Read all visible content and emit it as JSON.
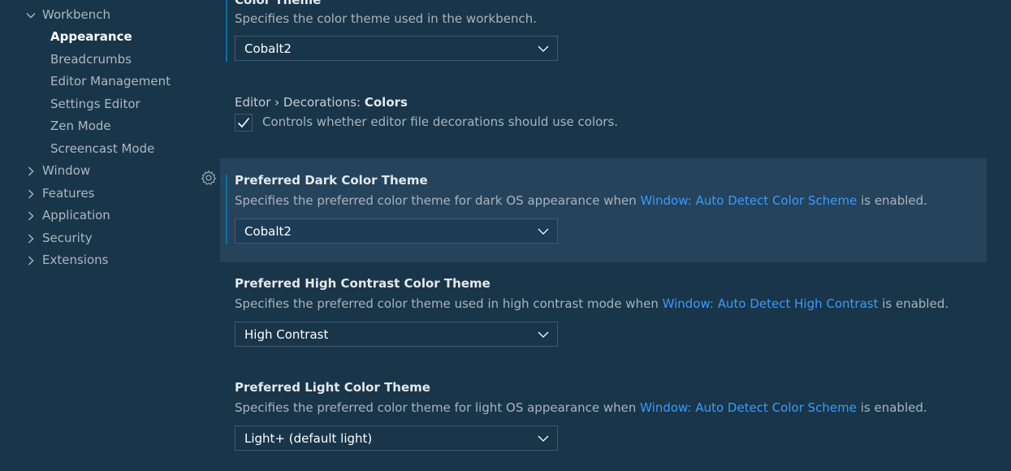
{
  "toc": {
    "items": [
      {
        "label": "Workbench",
        "level": 0,
        "expanded": true,
        "active": false
      },
      {
        "label": "Appearance",
        "level": 1,
        "active": true
      },
      {
        "label": "Breadcrumbs",
        "level": 1,
        "active": false
      },
      {
        "label": "Editor Management",
        "level": 1,
        "active": false
      },
      {
        "label": "Settings Editor",
        "level": 1,
        "active": false
      },
      {
        "label": "Zen Mode",
        "level": 1,
        "active": false
      },
      {
        "label": "Screencast Mode",
        "level": 1,
        "active": false
      },
      {
        "label": "Window",
        "level": 0,
        "expanded": false,
        "active": false
      },
      {
        "label": "Features",
        "level": 0,
        "expanded": false,
        "active": false
      },
      {
        "label": "Application",
        "level": 0,
        "expanded": false,
        "active": false
      },
      {
        "label": "Security",
        "level": 0,
        "expanded": false,
        "active": false
      },
      {
        "label": "Extensions",
        "level": 0,
        "expanded": false,
        "active": false
      }
    ]
  },
  "settings": {
    "color_theme": {
      "title": "Color Theme",
      "description": "Specifies the color theme used in the workbench.",
      "value": "Cobalt2"
    },
    "decorations_colors": {
      "category": "Editor › Decorations: ",
      "title": "Colors",
      "description": "Controls whether editor file decorations should use colors.",
      "checked": true
    },
    "preferred_dark": {
      "title": "Preferred Dark Color Theme",
      "description_before": "Specifies the preferred color theme for dark OS appearance when ",
      "link": "Window: Auto Detect Color Scheme",
      "description_after": " is enabled.",
      "value": "Cobalt2"
    },
    "preferred_high_contrast": {
      "title": "Preferred High Contrast Color Theme",
      "description_before": "Specifies the preferred color theme used in high contrast mode when ",
      "link": "Window: Auto Detect High Contrast",
      "description_after": " is enabled.",
      "value": "High Contrast"
    },
    "preferred_light": {
      "title": "Preferred Light Color Theme",
      "description_before": "Specifies the preferred color theme for light OS appearance when ",
      "link": "Window: Auto Detect Color Scheme",
      "description_after": " is enabled.",
      "value": "Light+ (default light)"
    }
  },
  "icons": {
    "gear": "gear-icon",
    "chevron_down": "chevron-down-icon",
    "chevron_right": "chevron-right-icon",
    "check": "check-icon"
  },
  "colors": {
    "background": "#193549",
    "focused_row": "#25435b",
    "link": "#3a9bff",
    "focus_bar": "#0d6fa5"
  }
}
